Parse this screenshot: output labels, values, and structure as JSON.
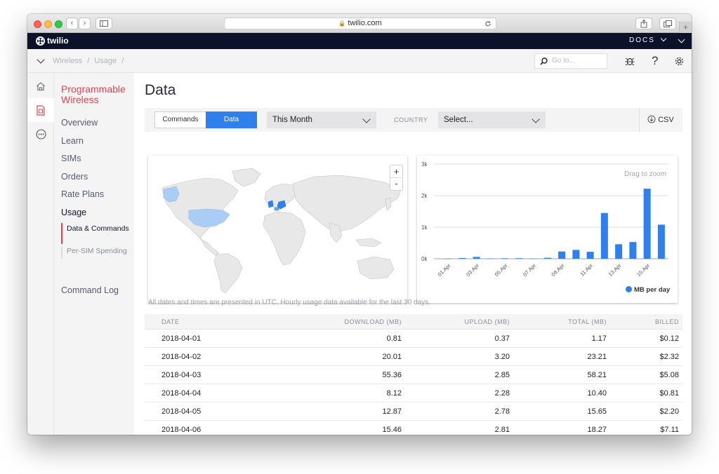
{
  "browser": {
    "url": "twilio.com"
  },
  "topbar": {
    "logo_text": "twilio",
    "docs_label": "DOCS"
  },
  "breadcrumb": {
    "items": [
      "Wireless",
      "Usage"
    ],
    "separator": "/",
    "search_placeholder": "Go to..."
  },
  "sidebar": {
    "section_title": "Programmable Wireless",
    "items": [
      {
        "label": "Overview"
      },
      {
        "label": "Learn"
      },
      {
        "label": "SIMs"
      },
      {
        "label": "Orders"
      },
      {
        "label": "Rate Plans"
      },
      {
        "label": "Usage"
      },
      {
        "label": "Command Log"
      }
    ],
    "subitems": [
      {
        "label": "Data & Commands"
      },
      {
        "label": "Per-SIM Spending"
      }
    ]
  },
  "main": {
    "title": "Data",
    "tabs": [
      {
        "label": "Commands",
        "active": false
      },
      {
        "label": "Data",
        "active": true
      }
    ],
    "period_select": "This Month",
    "country_label": "COUNTRY",
    "country_select": "Select...",
    "csv_label": "CSV",
    "map_zoom_in": "+",
    "map_zoom_out": "-",
    "footnote": "All dates and times are presented in UTC. Hourly usage data available for the last 30 days."
  },
  "chart_data": {
    "type": "bar",
    "hint": "Drag to zoom",
    "categories": [
      "01.Apr",
      "02.Apr",
      "03.Apr",
      "04.Apr",
      "05.Apr",
      "06.Apr",
      "07.Apr",
      "08.Apr",
      "09.Apr",
      "10.Apr",
      "11.Apr",
      "12.Apr",
      "13.Apr",
      "14.Apr",
      "15.Apr",
      "16.Apr"
    ],
    "tick_labels": [
      "01.Apr",
      "03.Apr",
      "05.Apr",
      "07.Apr",
      "09.Apr",
      "11.Apr",
      "13.Apr",
      "15.Apr"
    ],
    "series": [
      {
        "name": "MB per day",
        "color": "#2f80ed",
        "values": [
          1.17,
          23.21,
          58.21,
          10.4,
          15.65,
          18.27,
          5,
          30,
          230,
          280,
          220,
          1450,
          460,
          530,
          2220,
          1080
        ]
      }
    ],
    "yticks": [
      "0k",
      "1k",
      "2k",
      "3k"
    ],
    "ylim": [
      0,
      3000
    ],
    "grid": true,
    "legend_position": "bottom-right"
  },
  "table": {
    "headers": [
      "DATE",
      "DOWNLOAD (MB)",
      "UPLOAD (MB)",
      "TOTAL (MB)",
      "BILLED"
    ],
    "rows": [
      [
        "2018-04-01",
        "0.81",
        "0.37",
        "1.17",
        "$0.12"
      ],
      [
        "2018-04-02",
        "20.01",
        "3.20",
        "23.21",
        "$2.32"
      ],
      [
        "2018-04-03",
        "55.36",
        "2.85",
        "58.21",
        "$5.08"
      ],
      [
        "2018-04-04",
        "8.12",
        "2.28",
        "10.40",
        "$0.81"
      ],
      [
        "2018-04-05",
        "12.87",
        "2.78",
        "15.65",
        "$2.20"
      ],
      [
        "2018-04-06",
        "15.46",
        "2.81",
        "18.27",
        "$7.11"
      ]
    ]
  },
  "colors": {
    "accent": "#e8424f",
    "primary_blue": "#2f80ed",
    "nav_dark": "#0d122b",
    "map_highlight": "#a9cdf5"
  }
}
